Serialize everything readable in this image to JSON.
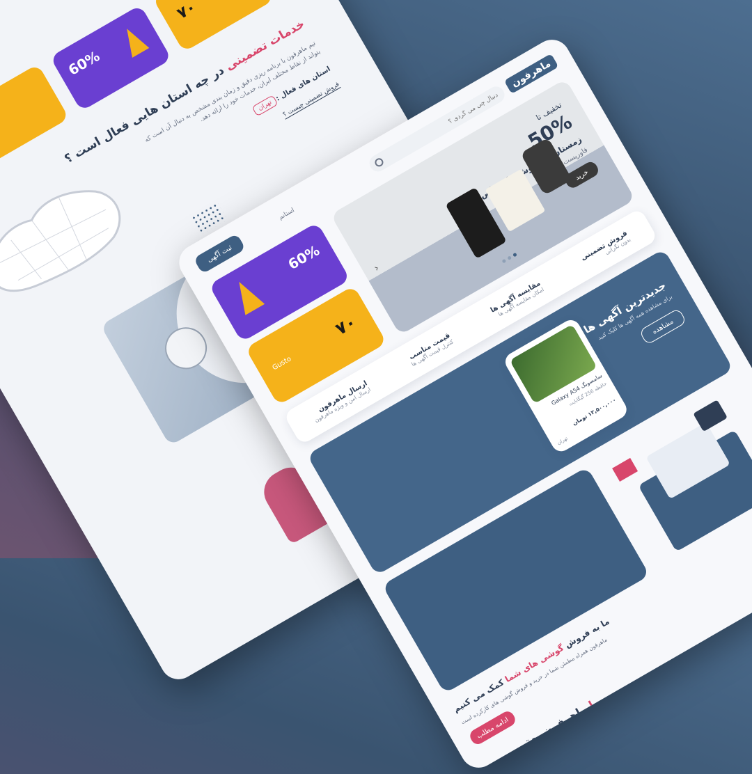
{
  "back": {
    "provinces_title": "در چه استان هایی فعال است ؟",
    "provinces_title_highlight": "خدمات تضمینی",
    "description": "تیم ماهرفون با برنامه ریزی دقیق و زمان بندی مشخص به دنبال آن است که بتواند از نقاط مختلف ایران، خدمات خود را ارائه دهد.",
    "active_label": "استان های فعال :",
    "active_chip": "تهران",
    "guaranteed_link": "فروش تضمینی چیست ؟",
    "banner_percent": "60%",
    "banner_price": "۷۰"
  },
  "front": {
    "logo": "ماهرفون",
    "search_placeholder": "دنبال چی می گردی ؟",
    "location": "استانم",
    "post_ad_button": "ثبت آگهی",
    "hero": {
      "discount_label": "تخفیف تا",
      "discount_value": "50%",
      "line1": "زمستان و دمنوش های خاص",
      "line2": "فاورپست",
      "cta": "خرید"
    },
    "promo": {
      "percent": "60%",
      "price": "۷۰",
      "label": "Gusto"
    },
    "features": [
      {
        "title": "فروش تضمینی",
        "sub": "بدون نگرانی"
      },
      {
        "title": "مقایسه آگهی ها",
        "sub": "امکان مقایسه آگهی ها"
      },
      {
        "title": "قیمت مناسب",
        "sub": "کنترل قیمت آگهی ها"
      },
      {
        "title": "ارسال ماهرفون",
        "sub": "ارسال امن و ویژه ماهرفون"
      }
    ],
    "latest": {
      "title": "جدیدترین آگهی ها",
      "sub": "برای مشاهده همه آگهی ها کلیک کنید",
      "button": "مشاهده"
    },
    "product": {
      "name": "سامسونگ Galaxy A54",
      "detail": "حافظه 256 گیگابایت",
      "price": "۱۲,۵۰۰,۰۰۰ تومان",
      "city": "تهران"
    },
    "about": {
      "title_pre": "ما به فروش",
      "title_highlight": "گوشی های شما",
      "title_post": "کمک می کنیم",
      "body": "ماهرفون همراه مطمئن شما در خرید و فروش گوشی های کارکرده است",
      "button": "ادامه مطلب"
    },
    "footer_title_pre": "با",
    "footer_title": "ماهرفون بهتر"
  },
  "colors": {
    "navy": "#3e5f82",
    "purple": "#6a3fd1",
    "yellow": "#f5b21a",
    "pink": "#d8466b"
  }
}
